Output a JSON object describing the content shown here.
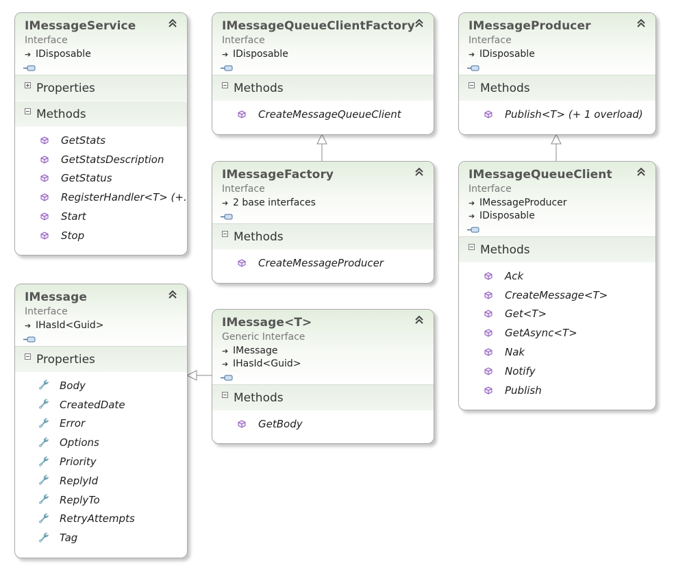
{
  "boxes": {
    "message_service": {
      "name": "IMessageService",
      "stereotype": "Interface",
      "bases": [
        "IDisposable"
      ],
      "sections": [
        "Properties",
        "Methods"
      ],
      "methods": [
        "GetStats",
        "GetStatsDescription",
        "GetStatus",
        "RegisterHandler<T>  (+...",
        "Start",
        "Stop"
      ]
    },
    "queue_client_factory": {
      "name": "IMessageQueueClientFactory",
      "stereotype": "Interface",
      "bases": [
        "IDisposable"
      ],
      "sections": [
        "Methods"
      ],
      "methods": [
        "CreateMessageQueueClient"
      ]
    },
    "producer": {
      "name": "IMessageProducer",
      "stereotype": "Interface",
      "bases": [
        "IDisposable"
      ],
      "sections": [
        "Methods"
      ],
      "methods": [
        "Publish<T> (+ 1 overload)"
      ]
    },
    "factory": {
      "name": "IMessageFactory",
      "stereotype": "Interface",
      "bases": [
        "2 base interfaces"
      ],
      "sections": [
        "Methods"
      ],
      "methods": [
        "CreateMessageProducer"
      ]
    },
    "queue_client": {
      "name": "IMessageQueueClient",
      "stereotype": "Interface",
      "bases": [
        "IMessageProducer",
        "IDisposable"
      ],
      "sections": [
        "Methods"
      ],
      "methods": [
        "Ack",
        "CreateMessage<T>",
        "Get<T>",
        "GetAsync<T>",
        "Nak",
        "Notify",
        "Publish"
      ]
    },
    "message": {
      "name": "IMessage",
      "stereotype": "Interface",
      "bases": [
        "IHasId<Guid>"
      ],
      "sections": [
        "Properties"
      ],
      "properties": [
        "Body",
        "CreatedDate",
        "Error",
        "Options",
        "Priority",
        "ReplyId",
        "ReplyTo",
        "RetryAttempts",
        "Tag"
      ]
    },
    "message_t": {
      "name": "IMessage<T>",
      "stereotype": "Generic Interface",
      "bases": [
        "IMessage",
        "IHasId<Guid>"
      ],
      "sections": [
        "Methods"
      ],
      "methods": [
        "GetBody"
      ]
    }
  },
  "colors": {
    "method_icon": "#8a53b8",
    "border": "#a9a9a9",
    "header_tint": "#e3eede"
  },
  "icons": {
    "collapse": "double-chevron-up-icon",
    "method": "method-cube-icon",
    "property": "wrench-icon",
    "base": "inherit-arrow-icon",
    "interface": "interface-lollipop-icon"
  }
}
